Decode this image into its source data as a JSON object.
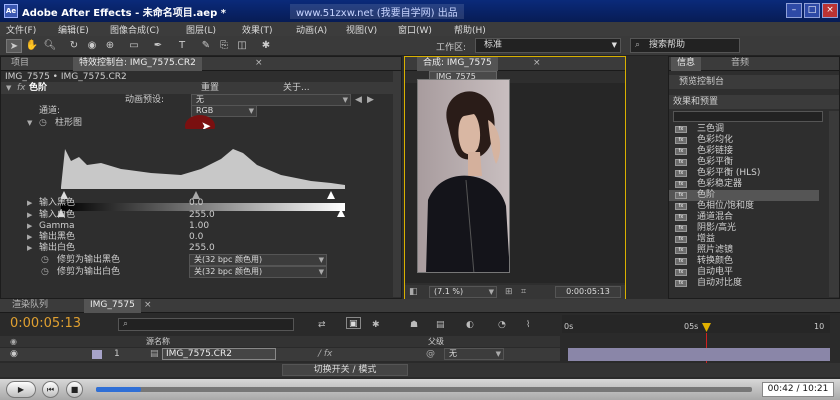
{
  "window": {
    "title": "Adobe After Effects - 未命名项目.aep *",
    "watermark": "www.51zxw.net (我要自学网) 出品",
    "app_icon": "Ae"
  },
  "menu": [
    "文件(F)",
    "编辑(E)",
    "图像合成(C)",
    "图层(L)",
    "效果(T)",
    "动画(A)",
    "视图(V)",
    "窗口(W)",
    "帮助(H)"
  ],
  "toolbar": {
    "workspace_label": "工作区:",
    "workspace_value": "标准",
    "help_search": "搜索帮助"
  },
  "left_panel": {
    "tabs": [
      "项目",
      "特效控制台: IMG_7575.CR2"
    ],
    "layer_path": "IMG_7575 • IMG_7575.CR2",
    "effect": {
      "fx": "fx",
      "name": "色阶",
      "reset": "重置",
      "about": "关于..."
    },
    "anim_preset_label": "动画预设:",
    "anim_preset_value": "无",
    "channel_label": "通道:",
    "channel_value": "RGB",
    "histogram_label": "柱形图",
    "params": [
      {
        "label": "输入黑色",
        "value": "0.0"
      },
      {
        "label": "输入白色",
        "value": "255.0"
      },
      {
        "label": "Gamma",
        "value": "1.00"
      },
      {
        "label": "输出黑色",
        "value": "0.0"
      },
      {
        "label": "输出白色",
        "value": "255.0"
      }
    ],
    "clip_black_label": "修剪为输出黑色",
    "clip_black_value": "关(32 bpc 颜色用)",
    "clip_white_label": "修剪为输出白色",
    "clip_white_value": "关(32 bpc 颜色用)"
  },
  "comp_panel": {
    "tab": "合成: IMG_7575",
    "sub_tab": "IMG_7575",
    "zoom": "(7.1 %)",
    "timecode": "0:00:05:13"
  },
  "right_panel": {
    "tabs": [
      "信息",
      "音频"
    ],
    "preview_tab": "预览控制台",
    "effects_tab": "效果和预置",
    "effects": [
      "三色调",
      "色彩均化",
      "色彩链接",
      "色彩平衡",
      "色彩平衡 (HLS)",
      "色彩稳定器",
      "色阶",
      "色相位/饱和度",
      "通道混合",
      "阴影/高光",
      "增益",
      "照片滤镜",
      "转换颜色",
      "自动电平",
      "自动对比度"
    ],
    "selected_effect": "色阶"
  },
  "timeline": {
    "tabs": [
      "渲染队列",
      "IMG_7575"
    ],
    "timecode": "0:00:05:13",
    "col_source": "源名称",
    "col_parent": "父级",
    "layer_number": "1",
    "layer_name": "IMG_7575.CR2",
    "parent_value": "无",
    "ruler": [
      "0s",
      "05s",
      "10"
    ],
    "switch_mode": "切换开关 / 模式"
  },
  "player": {
    "time": "00:42 / 10:21",
    "progress": 0.068
  }
}
